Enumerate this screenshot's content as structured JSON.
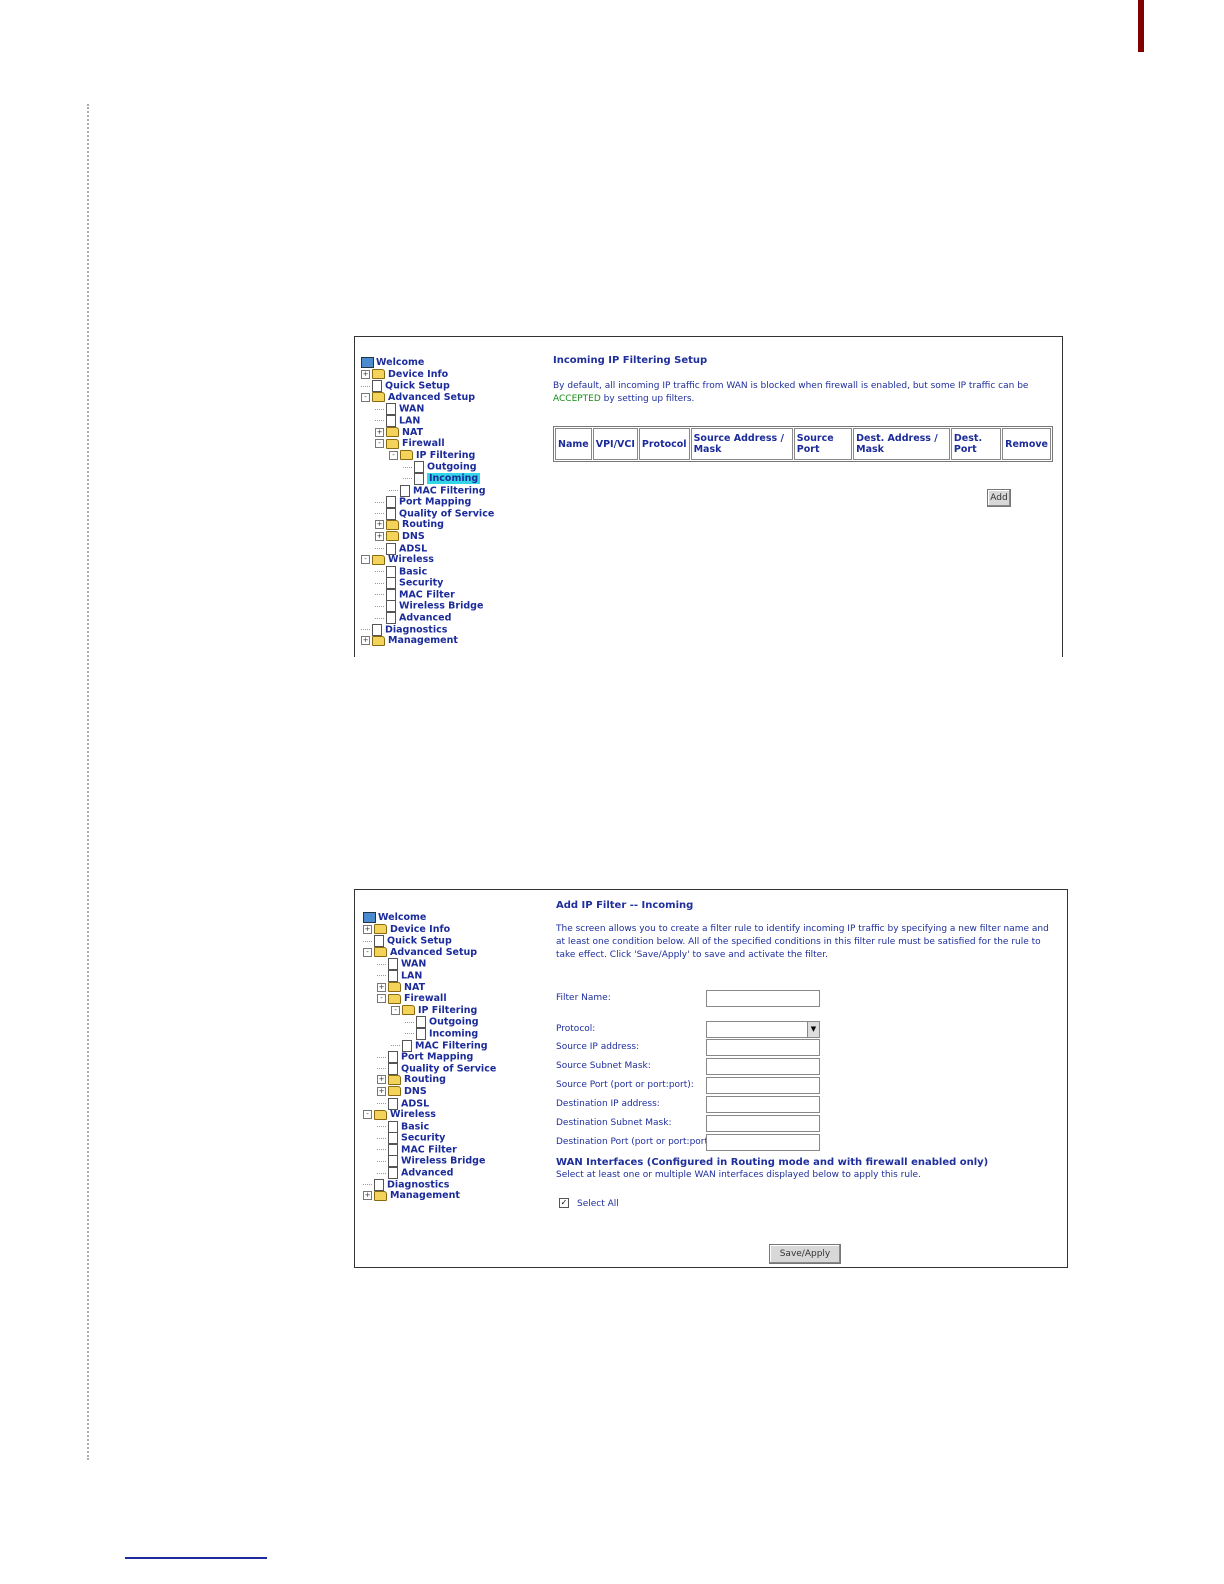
{
  "screen1": {
    "tree": [
      {
        "label": "Welcome",
        "icon": "globe-icon",
        "exp": "",
        "depth": 0
      },
      {
        "label": "Device Info",
        "icon": "folder-icon",
        "exp": "+",
        "depth": 0
      },
      {
        "label": "Quick Setup",
        "icon": "page-icon",
        "exp": "",
        "depth": 0
      },
      {
        "label": "Advanced Setup",
        "icon": "folder-icon",
        "exp": "-",
        "depth": 0
      },
      {
        "label": "WAN",
        "icon": "page-icon",
        "exp": "",
        "depth": 1
      },
      {
        "label": "LAN",
        "icon": "page-icon",
        "exp": "",
        "depth": 1
      },
      {
        "label": "NAT",
        "icon": "folder-icon",
        "exp": "+",
        "depth": 1
      },
      {
        "label": "Firewall",
        "icon": "folder-icon",
        "exp": "-",
        "depth": 1
      },
      {
        "label": "IP Filtering",
        "icon": "folder-icon",
        "exp": "-",
        "depth": 2
      },
      {
        "label": "Outgoing",
        "icon": "page-icon",
        "exp": "",
        "depth": 3
      },
      {
        "label": "Incoming",
        "icon": "page-icon",
        "exp": "",
        "depth": 3,
        "selected": true
      },
      {
        "label": "MAC Filtering",
        "icon": "page-icon",
        "exp": "",
        "depth": 2
      },
      {
        "label": "Port Mapping",
        "icon": "page-icon",
        "exp": "",
        "depth": 1
      },
      {
        "label": "Quality of Service",
        "icon": "page-icon",
        "exp": "",
        "depth": 1
      },
      {
        "label": "Routing",
        "icon": "folder-icon",
        "exp": "+",
        "depth": 1
      },
      {
        "label": "DNS",
        "icon": "folder-icon",
        "exp": "+",
        "depth": 1
      },
      {
        "label": "ADSL",
        "icon": "page-icon",
        "exp": "",
        "depth": 1
      },
      {
        "label": "Wireless",
        "icon": "folder-icon",
        "exp": "-",
        "depth": 0
      },
      {
        "label": "Basic",
        "icon": "page-icon",
        "exp": "",
        "depth": 1
      },
      {
        "label": "Security",
        "icon": "page-icon",
        "exp": "",
        "depth": 1
      },
      {
        "label": "MAC Filter",
        "icon": "page-icon",
        "exp": "",
        "depth": 1
      },
      {
        "label": "Wireless Bridge",
        "icon": "page-icon",
        "exp": "",
        "depth": 1
      },
      {
        "label": "Advanced",
        "icon": "page-icon",
        "exp": "",
        "depth": 1
      },
      {
        "label": "Diagnostics",
        "icon": "page-icon",
        "exp": "",
        "depth": 0
      },
      {
        "label": "Management",
        "icon": "folder-icon",
        "exp": "+",
        "depth": 0
      }
    ],
    "title": "Incoming IP Filtering Setup",
    "desc_before": "By default, all incoming IP traffic from WAN is blocked when firewall is enabled, but some IP traffic can be ",
    "desc_accepted": "ACCEPTED",
    "desc_after": " by setting up filters.",
    "columns": [
      "Name",
      "VPI/VCI",
      "Protocol",
      "Source Address / Mask",
      "Source Port",
      "Dest. Address / Mask",
      "Dest. Port",
      "Remove"
    ],
    "add_label": "Add"
  },
  "screen2": {
    "tree": [
      {
        "label": "Welcome",
        "icon": "globe-icon",
        "exp": "",
        "depth": 0
      },
      {
        "label": "Device Info",
        "icon": "folder-icon",
        "exp": "+",
        "depth": 0
      },
      {
        "label": "Quick Setup",
        "icon": "page-icon",
        "exp": "",
        "depth": 0
      },
      {
        "label": "Advanced Setup",
        "icon": "folder-icon",
        "exp": "-",
        "depth": 0
      },
      {
        "label": "WAN",
        "icon": "page-icon",
        "exp": "",
        "depth": 1
      },
      {
        "label": "LAN",
        "icon": "page-icon",
        "exp": "",
        "depth": 1
      },
      {
        "label": "NAT",
        "icon": "folder-icon",
        "exp": "+",
        "depth": 1
      },
      {
        "label": "Firewall",
        "icon": "folder-icon",
        "exp": "-",
        "depth": 1
      },
      {
        "label": "IP Filtering",
        "icon": "folder-icon",
        "exp": "-",
        "depth": 2
      },
      {
        "label": "Outgoing",
        "icon": "page-icon",
        "exp": "",
        "depth": 3
      },
      {
        "label": "Incoming",
        "icon": "page-icon",
        "exp": "",
        "depth": 3
      },
      {
        "label": "MAC Filtering",
        "icon": "page-icon",
        "exp": "",
        "depth": 2
      },
      {
        "label": "Port Mapping",
        "icon": "page-icon",
        "exp": "",
        "depth": 1
      },
      {
        "label": "Quality of Service",
        "icon": "page-icon",
        "exp": "",
        "depth": 1
      },
      {
        "label": "Routing",
        "icon": "folder-icon",
        "exp": "+",
        "depth": 1
      },
      {
        "label": "DNS",
        "icon": "folder-icon",
        "exp": "+",
        "depth": 1
      },
      {
        "label": "ADSL",
        "icon": "page-icon",
        "exp": "",
        "depth": 1
      },
      {
        "label": "Wireless",
        "icon": "folder-icon",
        "exp": "-",
        "depth": 0
      },
      {
        "label": "Basic",
        "icon": "page-icon",
        "exp": "",
        "depth": 1
      },
      {
        "label": "Security",
        "icon": "page-icon",
        "exp": "",
        "depth": 1
      },
      {
        "label": "MAC Filter",
        "icon": "page-icon",
        "exp": "",
        "depth": 1
      },
      {
        "label": "Wireless Bridge",
        "icon": "page-icon",
        "exp": "",
        "depth": 1
      },
      {
        "label": "Advanced",
        "icon": "page-icon",
        "exp": "",
        "depth": 1
      },
      {
        "label": "Diagnostics",
        "icon": "page-icon",
        "exp": "",
        "depth": 0
      },
      {
        "label": "Management",
        "icon": "folder-icon",
        "exp": "+",
        "depth": 0
      }
    ],
    "title": "Add IP Filter -- Incoming",
    "desc": "The screen allows you to create a filter rule to identify incoming IP traffic by specifying a new filter name and at least one condition below. All of the specified conditions in this filter rule must be satisfied for the rule to take effect. Click 'Save/Apply' to save and activate the filter.",
    "filter_name_label": "Filter Name:",
    "protocol_label": "Protocol:",
    "fields": [
      {
        "label": "Source IP address:",
        "value": ""
      },
      {
        "label": "Source Subnet Mask:",
        "value": ""
      },
      {
        "label": "Source Port (port or port:port):",
        "value": ""
      },
      {
        "label": "Destination IP address:",
        "value": ""
      },
      {
        "label": "Destination Subnet Mask:",
        "value": ""
      },
      {
        "label": "Destination Port (port or port:port):",
        "value": ""
      }
    ],
    "wan_heading": "WAN Interfaces (Configured in Routing mode and with firewall enabled only)",
    "wan_desc": "Select at least one or multiple WAN interfaces displayed below to apply this rule.",
    "select_all_label": "Select All",
    "select_all_checked": true,
    "save_label": "Save/Apply"
  },
  "colors": {
    "link": "#1b2b9a",
    "accepted": "#1a8a1a",
    "selected_bg": "#33d6e6",
    "margin_bar": "#800000"
  }
}
